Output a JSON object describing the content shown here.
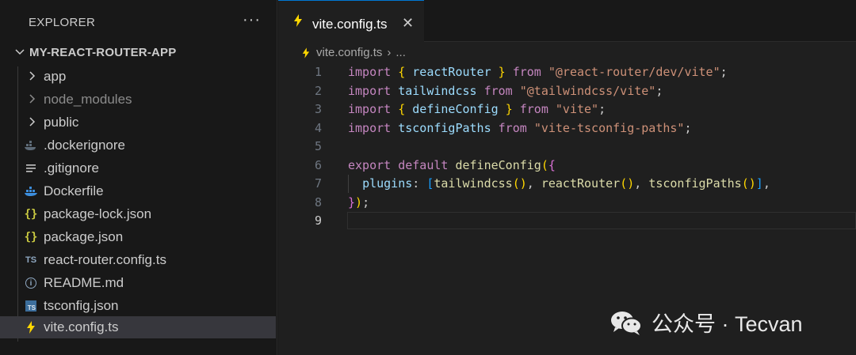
{
  "sidebar": {
    "title": "EXPLORER",
    "more": "···",
    "project": "MY-REACT-ROUTER-APP",
    "items": [
      {
        "label": "app",
        "kind": "folder",
        "icon": "chevron-right-icon"
      },
      {
        "label": "node_modules",
        "kind": "folder",
        "icon": "chevron-right-icon"
      },
      {
        "label": "public",
        "kind": "folder",
        "icon": "chevron-right-icon"
      },
      {
        "label": ".dockerignore",
        "kind": "file",
        "icon": "docker-icon"
      },
      {
        "label": ".gitignore",
        "kind": "file",
        "icon": "lines-icon"
      },
      {
        "label": "Dockerfile",
        "kind": "file",
        "icon": "docker-icon"
      },
      {
        "label": "package-lock.json",
        "kind": "file",
        "icon": "json-braces-icon",
        "glyph": "{}"
      },
      {
        "label": "package.json",
        "kind": "file",
        "icon": "json-braces-icon",
        "glyph": "{}"
      },
      {
        "label": "react-router.config.ts",
        "kind": "file",
        "icon": "typescript-icon",
        "glyph": "TS"
      },
      {
        "label": "README.md",
        "kind": "file",
        "icon": "info-icon",
        "glyph": "i"
      },
      {
        "label": "tsconfig.json",
        "kind": "file",
        "icon": "tsconfig-icon",
        "glyph": "TS"
      },
      {
        "label": "vite.config.ts",
        "kind": "file",
        "icon": "vite-bolt-icon",
        "selected": true
      }
    ]
  },
  "editor": {
    "tab_label": "vite.config.ts",
    "tab_close": "✕",
    "breadcrumb_file": "vite.config.ts",
    "breadcrumb_sep": "›",
    "breadcrumb_more": "...",
    "line_numbers": [
      "1",
      "2",
      "3",
      "4",
      "5",
      "6",
      "7",
      "8",
      "9"
    ],
    "active_line": "9",
    "code": {
      "l1": {
        "a": "import",
        "b": " ",
        "c": "{",
        "d": " reactRouter ",
        "e": "}",
        "f": " ",
        "g": "from",
        "h": " ",
        "i": "\"@react-router/dev/vite\"",
        "j": ";"
      },
      "l2": {
        "a": "import",
        "b": " tailwindcss ",
        "c": "from",
        "d": " ",
        "e": "\"@tailwindcss/vite\"",
        "f": ";"
      },
      "l3": {
        "a": "import",
        "b": " ",
        "c": "{",
        "d": " defineConfig ",
        "e": "}",
        "f": " ",
        "g": "from",
        "h": " ",
        "i": "\"vite\"",
        "j": ";"
      },
      "l4": {
        "a": "import",
        "b": " tsconfigPaths ",
        "c": "from",
        "d": " ",
        "e": "\"vite-tsconfig-paths\"",
        "f": ";"
      },
      "l6": {
        "a": "export",
        "b": " ",
        "c": "default",
        "d": " ",
        "e": "defineConfig",
        "f": "(",
        "g": "{"
      },
      "l7": {
        "a": "  ",
        "b": "plugins",
        "c": ": ",
        "d": "[",
        "e": "tailwindcss",
        "f": "()",
        "g": ", ",
        "h": "reactRouter",
        "i": "()",
        "j": ", ",
        "k": "tsconfigPaths",
        "l": "()",
        "m": "]",
        "n": ","
      },
      "l8": {
        "a": "}",
        "b": ")",
        "c": ";"
      }
    }
  },
  "watermark": {
    "text": "公众号 · Tecvan",
    "icon": "wechat-icon"
  },
  "colors": {
    "accent": "#0078d4",
    "bolt": "#ffd700",
    "keyword": "#c586c0",
    "string": "#ce9178",
    "function": "#dcdcaa",
    "variable": "#9cdcfe"
  }
}
